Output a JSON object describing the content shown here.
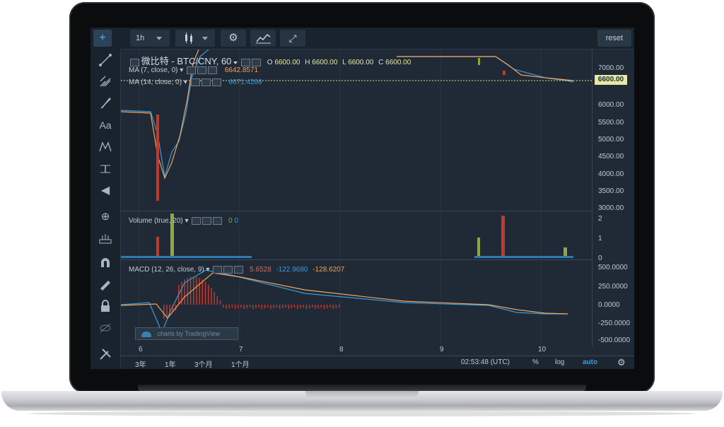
{
  "toolbar": {
    "interval": "1h",
    "reset": "reset"
  },
  "legend": {
    "symbol": "微比特 - BTC/CNY, 60",
    "o_label": "O",
    "o_val": "6600.00",
    "h_label": "H",
    "h_val": "6600.00",
    "l_label": "L",
    "l_val": "6600.00",
    "c_label": "C",
    "c_val": "6600.00",
    "ma7": "MA (7, close, 0)",
    "ma7_val": "6642.8571",
    "ma14": "MA (14, close, 0)",
    "ma14_val": "6671.4286",
    "volume": "Volume (true, 20)",
    "vol_a": "0",
    "vol_b": "0",
    "macd": "MACD (12, 26, close, 9)",
    "macd_a": "5.6528",
    "macd_b": "-122.9680",
    "macd_c": "-128.6207"
  },
  "price_axis": {
    "labels": [
      "7000.00",
      "6000.00",
      "5500.00",
      "5000.00",
      "4500.00",
      "4000.00",
      "3500.00",
      "3000.00"
    ],
    "current": "6600.00"
  },
  "volume_axis": [
    "2",
    "1",
    "0"
  ],
  "macd_axis": [
    "500.0000",
    "250.0000",
    "0.0000",
    "-250.0000",
    "-500.0000"
  ],
  "time_axis": [
    "6",
    "7",
    "8",
    "9",
    "10"
  ],
  "bottom": {
    "ranges": [
      "3年",
      "1年",
      "3个月",
      "1个月"
    ],
    "clock": "02:53:48 (UTC)",
    "percent": "%",
    "log": "log",
    "auto": "auto"
  },
  "watermark": "charts by TradingView",
  "colors": {
    "bg": "#1f2a36",
    "ma7": "#f0a35e",
    "ma14": "#3b9ad9",
    "down": "#c0392b",
    "up": "#8fa83a",
    "auto": "#3b9ad9"
  }
}
